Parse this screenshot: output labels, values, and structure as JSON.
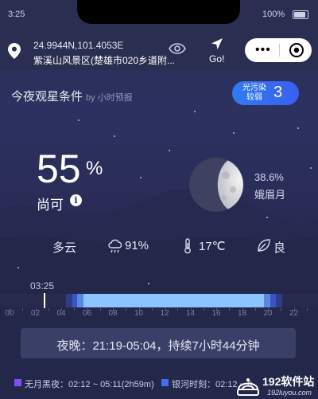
{
  "status_bar": {
    "time": "3:25",
    "battery": "100%"
  },
  "header": {
    "coords": "24.9944N,101.4053E",
    "place": "紫溪山风景区(楚雄市020乡道附...",
    "go_label": "Go!"
  },
  "capsule": {
    "more": "•••"
  },
  "observing": {
    "title": "今夜观星条件",
    "subtitle": "by 小时预报",
    "light_pollution_label": "光污染较弱",
    "light_pollution_value": "3",
    "score_number": "55",
    "score_unit": "%",
    "quality": "尚可",
    "info_symbol": "i"
  },
  "moon": {
    "illumination": "38.6%",
    "phase": "娥眉月",
    "illumination_fraction": 0.386
  },
  "conditions": {
    "cloud": "多云",
    "humidity": "91%",
    "temperature": "17℃",
    "air": "良"
  },
  "timeline": {
    "current_time": "03:25",
    "hour_labels": [
      "00",
      "02",
      "04",
      "06",
      "08",
      "10",
      "12",
      "14",
      "16",
      "18",
      "20",
      "22"
    ]
  },
  "night": {
    "text": "夜晚：21:19-05:04，持续7小时44分钟"
  },
  "legend": {
    "moonless": "无月黑夜：02:12 ~ 05:11(2h59m)",
    "milky_way": "银河时刻：02:12 ~ 0",
    "colors": {
      "moonless": "#7f4ff0",
      "milky_way": "#3f6df5"
    }
  },
  "watermark": {
    "name": "192软件站",
    "url": "192luyou.com"
  }
}
